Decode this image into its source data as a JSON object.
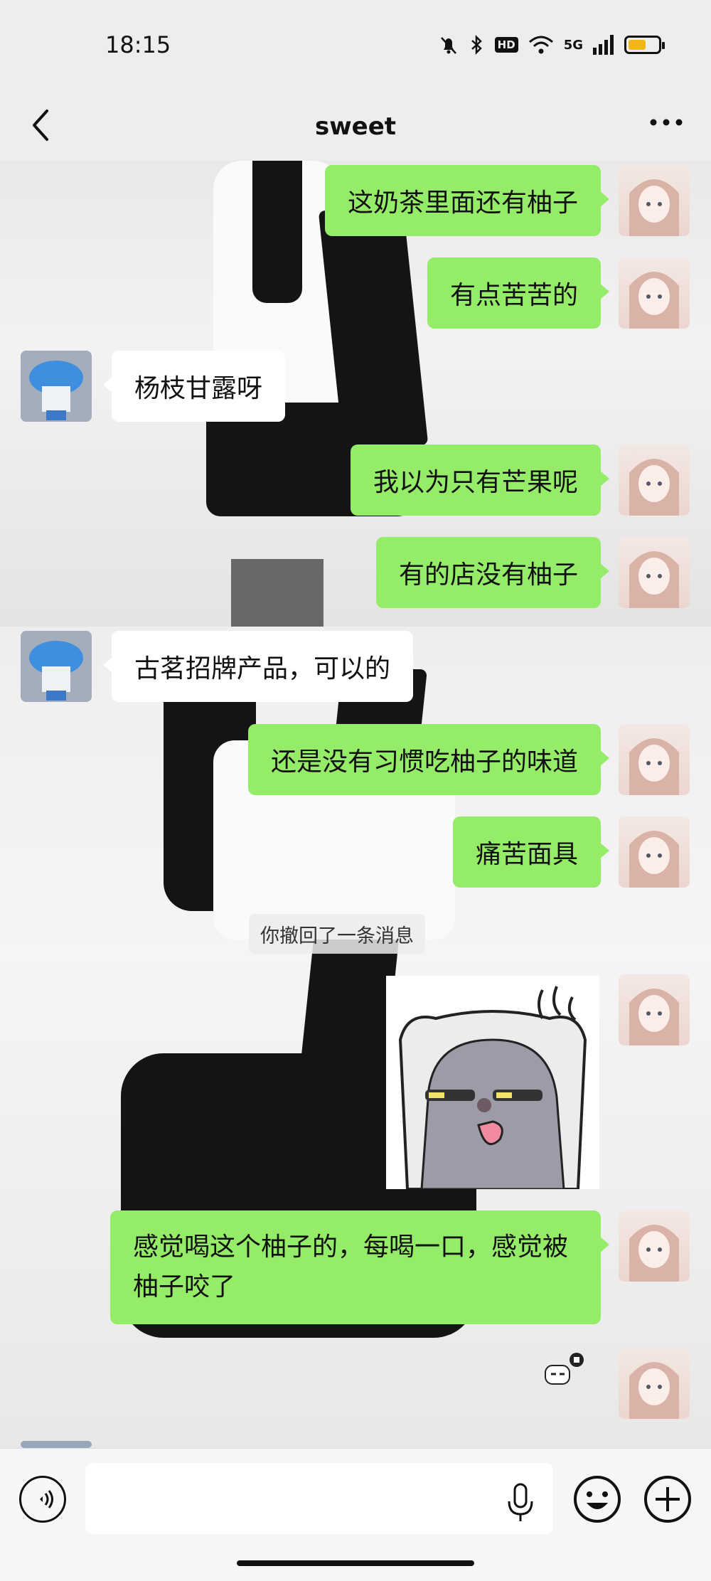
{
  "status_bar": {
    "time": "18:15",
    "network": "5G",
    "hd": "HD",
    "battery_level": 0.6
  },
  "nav": {
    "title": "sweet"
  },
  "messages": [
    {
      "side": "me",
      "text": "这奶茶里面还有柚子"
    },
    {
      "side": "me",
      "text": "有点苦苦的"
    },
    {
      "side": "peer",
      "text": "杨枝甘露呀"
    },
    {
      "side": "me",
      "text": "我以为只有芒果呢"
    },
    {
      "side": "me",
      "text": "有的店没有柚子"
    },
    {
      "side": "peer",
      "text": "古茗招牌产品，可以的"
    },
    {
      "side": "me",
      "text": "还是没有习惯吃柚子的味道"
    },
    {
      "side": "me",
      "text": "痛苦面具"
    },
    {
      "side": "system",
      "text": "你撤回了一条消息"
    },
    {
      "side": "me",
      "type": "sticker"
    },
    {
      "side": "me",
      "text": "感觉喝这个柚子的，每喝一口，感觉被柚子咬了"
    },
    {
      "side": "me",
      "type": "small-sticker"
    }
  ],
  "icons": {
    "back": "chevron-left-icon",
    "more": "ellipsis-icon",
    "voice": "voice-icon",
    "mic": "microphone-icon",
    "emoji": "smiley-icon",
    "plus": "plus-icon"
  },
  "colors": {
    "my_bubble": "#95ec69",
    "peer_bubble": "#ffffff",
    "background": "#ededed"
  }
}
